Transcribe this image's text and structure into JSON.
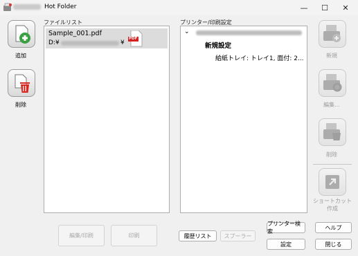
{
  "window": {
    "title": "Hot Folder",
    "minimize_glyph": "—",
    "maximize_glyph": "☐",
    "close_glyph": "✕"
  },
  "file_list": {
    "label": "ファイルリスト",
    "items": [
      {
        "name": "Sample_001.pdf",
        "path_prefix": "D:¥",
        "path_suffix": "¥",
        "icon": "pdf-file-icon",
        "icon_text": "PDF"
      }
    ]
  },
  "printer_settings": {
    "label": "プリンター/印刷設定",
    "expand_glyph": "⌄",
    "setting_name": "新規設定",
    "setting_detail": "給紙トレイ: トレイ1, 面付: 2..."
  },
  "left_toolbar": {
    "add_label": "追加",
    "delete_label": "削除"
  },
  "right_toolbar": {
    "new_label": "新規",
    "edit_label": "編集...",
    "delete_label": "削除",
    "shortcut_label": "ショートカット作成"
  },
  "bottom": {
    "edit_print_label": "編集/印刷",
    "print_label": "印刷",
    "history_label": "履歴リスト",
    "spooler_label": "スプーラー",
    "printer_search_label": "プリンター検索",
    "settings_label": "設定",
    "help_label": "ヘルプ",
    "close_label": "閉じる"
  },
  "colors": {
    "add_green": "#3aa142",
    "delete_red": "#d8261f",
    "pdf_red": "#d42020"
  }
}
